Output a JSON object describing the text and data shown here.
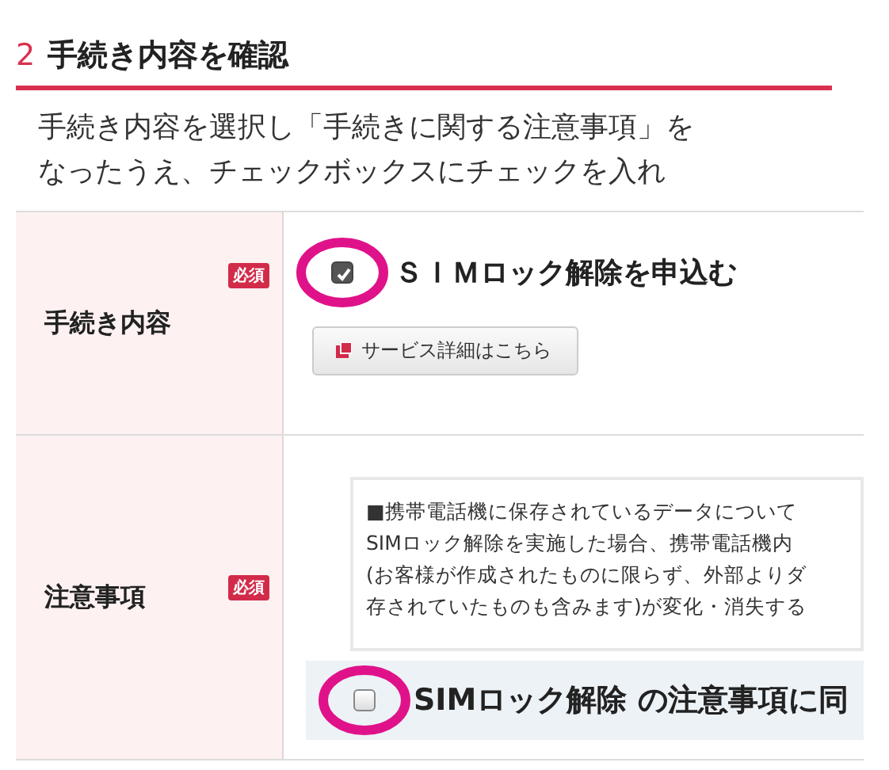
{
  "step": {
    "number": "2",
    "title": "手続き内容を確認"
  },
  "intro": [
    "手続き内容を選択し「手続きに関する注意事項」を",
    "なったうえ、チェックボックスにチェックを入れ"
  ],
  "rows": [
    {
      "kind": "option",
      "label": "手続き内容",
      "badge": "必須",
      "option": {
        "label": "ＳＩＭロック解除を申込む",
        "checked": true,
        "circled": true
      },
      "link_button": "サービス詳細はこちら"
    },
    {
      "kind": "notice",
      "label": "注意事項",
      "badge": "必須",
      "notice_lines": [
        "■携帯電話機に保存されているデータについて",
        "SIMロック解除を実施した場合、携帯電話機内",
        "(お客様が作成されたものに限らず、外部よりダ",
        "存されていたものも含みます)が変化・消失する"
      ],
      "agree": {
        "label": "SIMロック解除 の注意事項に同",
        "checked": false,
        "circled": true
      }
    }
  ]
}
